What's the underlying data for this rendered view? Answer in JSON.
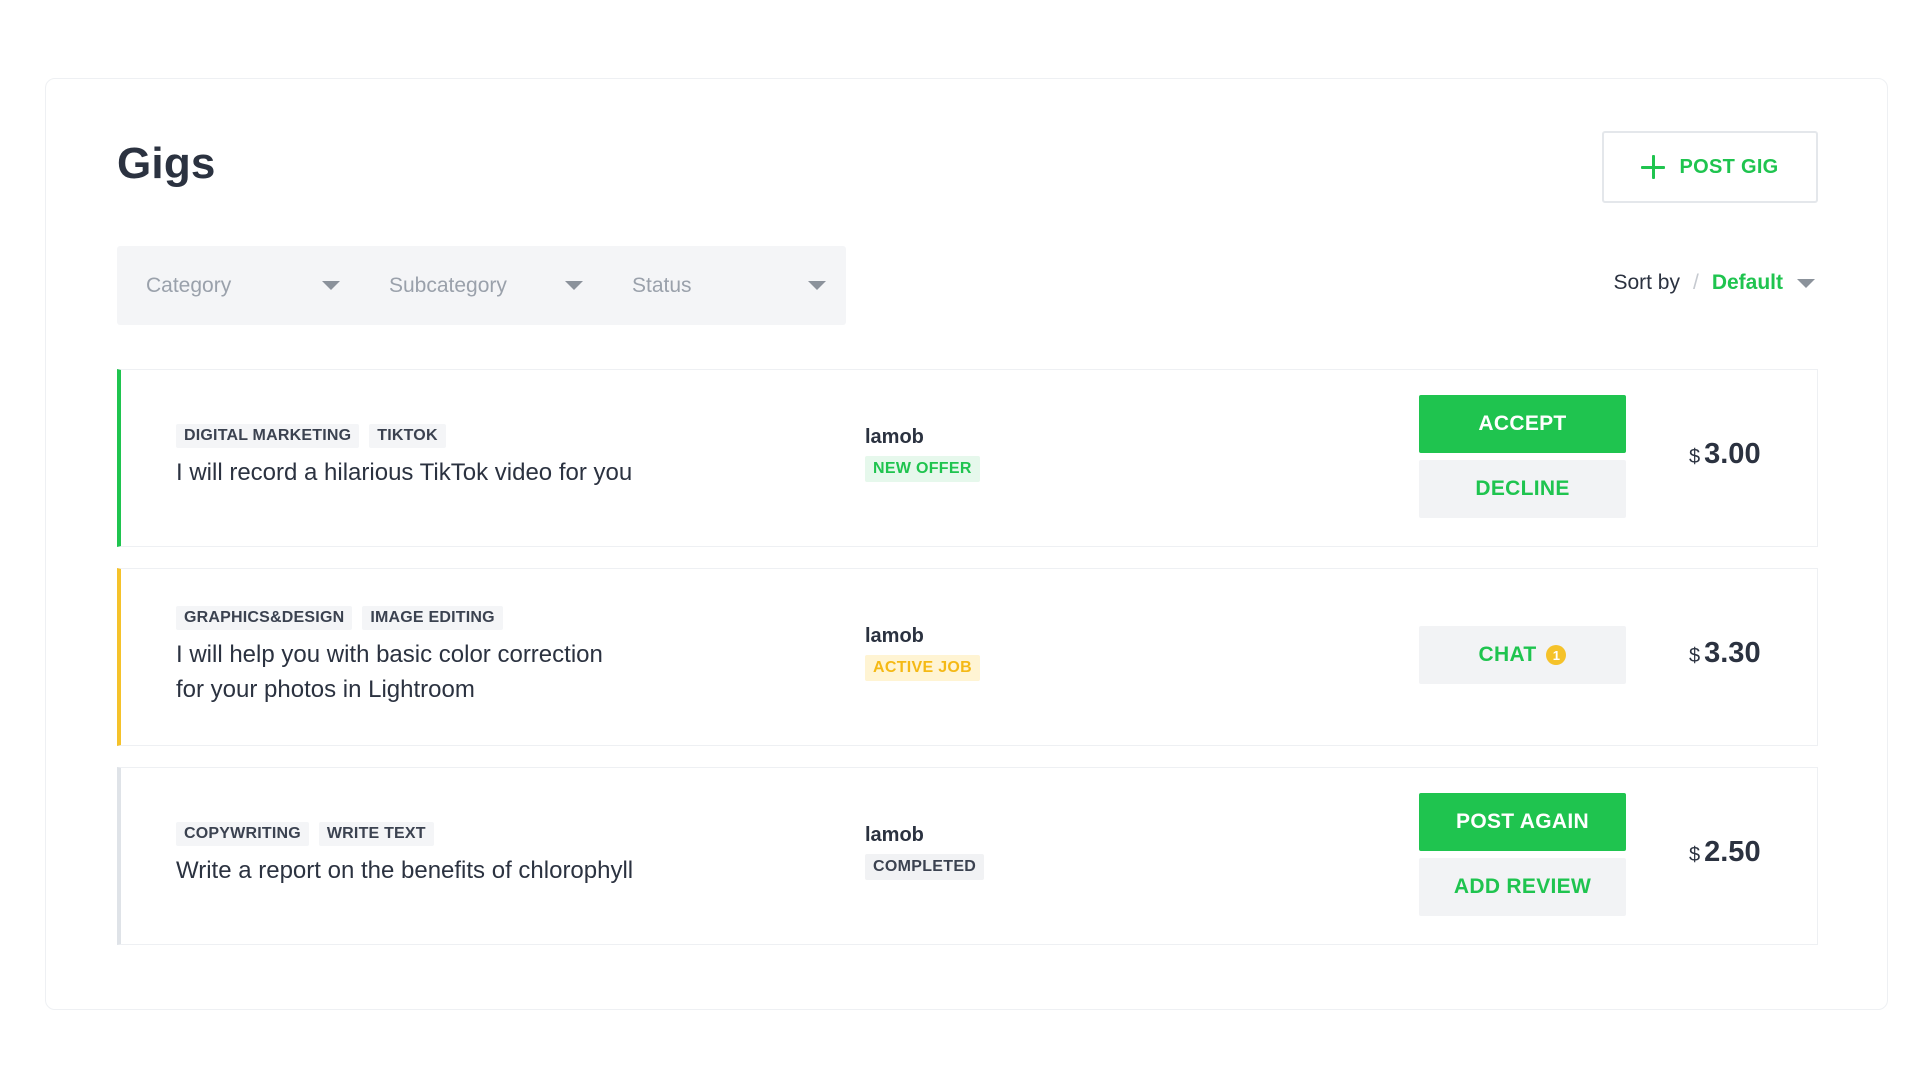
{
  "header": {
    "title": "Gigs",
    "post_gig_label": "POST GIG"
  },
  "filters": {
    "category": "Category",
    "subcategory": "Subcategory",
    "status": "Status"
  },
  "sort": {
    "label": "Sort by",
    "separator": "/",
    "value": "Default"
  },
  "gigs": [
    {
      "tags": [
        "DIGITAL MARKETING",
        "TIKTOK"
      ],
      "title": "I will record a hilarious TikTok video for you",
      "user": "lamob",
      "status": "NEW OFFER",
      "primary_action": "ACCEPT",
      "secondary_action": "DECLINE",
      "currency": "$",
      "price": "3.00",
      "accent_color": "#1fc44f"
    },
    {
      "tags": [
        "GRAPHICS&DESIGN",
        "IMAGE EDITING"
      ],
      "title_line1": "I will help you with basic color correction",
      "title_line2": "for your photos in Lightroom",
      "user": "lamob",
      "status": "ACTIVE JOB",
      "chat_action": "CHAT",
      "chat_badge": "1",
      "currency": "$",
      "price": "3.30",
      "accent_color": "#f5c22a"
    },
    {
      "tags": [
        "COPYWRITING",
        "WRITE TEXT"
      ],
      "title": "Write a report on the benefits of chlorophyll",
      "user": "lamob",
      "status": "COMPLETED",
      "primary_action": "POST AGAIN",
      "secondary_action": "ADD REVIEW",
      "currency": "$",
      "price": "2.50",
      "accent_color": "#dfe3e8"
    }
  ],
  "colors": {
    "accent_green": "#1fc44f",
    "accent_yellow": "#f5c22a",
    "text_dark": "#2b3240"
  }
}
